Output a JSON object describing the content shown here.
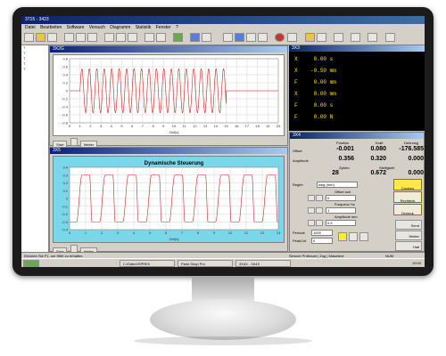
{
  "app": {
    "title": "3715 - 3423",
    "menu": [
      "Datei",
      "Bearbeiten",
      "Software",
      "Versuch",
      "Diagramm",
      "Statistik",
      "Fenster",
      "?"
    ]
  },
  "tree": {
    "items": [
      "T",
      "T",
      "T",
      "T",
      "T"
    ]
  },
  "upper_window": {
    "title": "3X2G",
    "yaxis_ticks": [
      "0.8",
      "0.6",
      "0.4",
      "0.2",
      "0",
      "-0.2",
      "-0.4",
      "-0.6",
      "-0.8"
    ],
    "xaxis_ticks": [
      "0",
      "1",
      "2",
      "3",
      "4",
      "5",
      "6",
      "7",
      "8",
      "9",
      "10",
      "11",
      "12",
      "13",
      "14",
      "15",
      "16",
      "17",
      "18",
      "19",
      "20"
    ],
    "xlabel": "Zeit[s]",
    "buttons": [
      "Start",
      "",
      "Weiter"
    ]
  },
  "lower_window": {
    "title": "3X5",
    "chart_title": "Dynamische Steuerung",
    "yaxis_ticks": [
      "0.4",
      "0.3",
      "0.2",
      "0.1",
      "0",
      "-0.1",
      "-0.2",
      "-0.3",
      "-0.4"
    ],
    "xaxis_ticks": [
      "0",
      "1",
      "2",
      "3",
      "4",
      "5",
      "6",
      "7",
      "8",
      "9",
      "10",
      "11",
      "12",
      "13"
    ],
    "xlabel": "Zeit[s]",
    "buttons": [
      "Start",
      "",
      "Weiter"
    ]
  },
  "measurements": {
    "title": "3X3",
    "rows": [
      {
        "label": "X",
        "value": "0.00",
        "unit": "s"
      },
      {
        "label": "X",
        "value": "-0.50",
        "unit": "mm"
      },
      {
        "label": "F",
        "value": "0.00",
        "unit": "mm"
      },
      {
        "label": "X",
        "value": "0.00",
        "unit": "mm"
      },
      {
        "label": "F",
        "value": "0.00",
        "unit": "s"
      },
      {
        "label": "F",
        "value": "0.00",
        "unit": "N"
      }
    ]
  },
  "control": {
    "title": "3X4",
    "col_headers": [
      "Position",
      "Kraft",
      "Dehnung"
    ],
    "offset_label": "Offset",
    "offset_values": [
      "-0.001",
      "0.080",
      "-176.585"
    ],
    "amplitude_label": "Amplitude",
    "amplitude_values": [
      "0.356",
      "0.320",
      "0.000"
    ],
    "zyklen_label": "Zyklen",
    "steifigkeit_label": "Steifigkeit",
    "zyklen_value": "28",
    "steifigkeit_value": "0.672",
    "last_value": "0.000",
    "regler_label": "Regler",
    "regler_value": "weg (mm)",
    "offset_soll_label": "Offset soll",
    "frequenz_label": "Frequenz Hz",
    "amplitude_soll_label": "Amplitude mm",
    "offset_field": "0",
    "frequenz_field": "1",
    "amplitude_field": "0.5",
    "periode_label": "Periode",
    "periode_value": "1000",
    "peak_label": "PeakCnt",
    "peak_value": "0",
    "wave_buttons": [
      "Cosinus",
      "Rechteck",
      "Dreieck"
    ],
    "action_buttons": [
      "Send",
      "Weiter",
      "Halt"
    ]
  },
  "status": {
    "left": "Drücken Sie F1, um Hilfe zu erhalten.",
    "right": "Simone Prüfraum | Zug | Maschine",
    "mode": "NUM"
  },
  "taskbar": {
    "items": [
      "C:\\Daten\\SPREX",
      "Paint Shop Pro",
      "3X4X - 3X4X"
    ],
    "clock": "19:00"
  },
  "colors": {
    "red_signal": "#cc2222",
    "cyan_plot_bg": "#7ad7ea",
    "yellow_text": "#ffe000"
  },
  "chart_data": [
    {
      "type": "line",
      "title": "",
      "xlabel": "Zeit[s]",
      "ylabel": "",
      "xlim": [
        0,
        20
      ],
      "ylim": [
        -0.8,
        0.8
      ],
      "series": [
        {
          "values_desc": "sinusoid amplitude ~0.55",
          "amplitude": 0.55,
          "cycles": 28
        }
      ]
    },
    {
      "type": "line",
      "title": "Dynamische Steuerung",
      "xlabel": "Zeit[s]",
      "ylabel": "",
      "xlim": [
        0,
        13
      ],
      "ylim": [
        -0.4,
        0.4
      ],
      "series": [
        {
          "amplitude": 0.3,
          "cycles": 9
        }
      ]
    }
  ]
}
